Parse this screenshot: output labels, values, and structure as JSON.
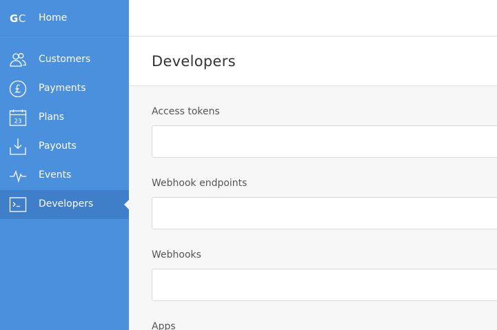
{
  "sidebar": {
    "logo": {
      "g": "G",
      "c": "C"
    },
    "home_label": "Home",
    "items": [
      {
        "label": "Customers",
        "icon": "customers-icon"
      },
      {
        "label": "Payments",
        "icon": "pound-icon"
      },
      {
        "label": "Plans",
        "icon": "calendar-icon",
        "icon_text": "23"
      },
      {
        "label": "Payouts",
        "icon": "download-icon"
      },
      {
        "label": "Events",
        "icon": "pulse-icon"
      },
      {
        "label": "Developers",
        "icon": "terminal-icon",
        "active": true
      }
    ]
  },
  "main": {
    "title": "Developers",
    "sections": [
      {
        "label": "Access tokens"
      },
      {
        "label": "Webhook endpoints"
      },
      {
        "label": "Webhooks"
      },
      {
        "label": "Apps"
      }
    ]
  },
  "colors": {
    "sidebar_bg": "#4a90dd",
    "sidebar_active": "#3f7ec9",
    "page_bg": "#f7f7f7"
  }
}
